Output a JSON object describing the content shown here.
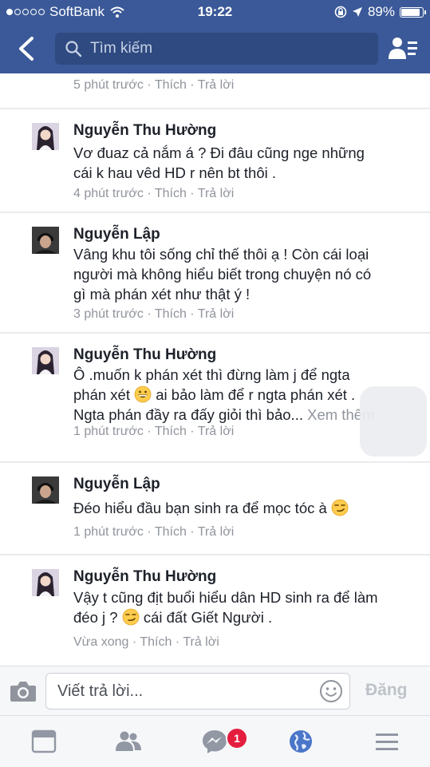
{
  "status_bar": {
    "carrier": "SoftBank",
    "time": "19:22",
    "battery_percent": "89%",
    "battery_level": 0.89
  },
  "nav": {
    "search_placeholder": "Tìm kiếm"
  },
  "comments": [
    {
      "author": "",
      "lines": [],
      "time": "5 phút trước",
      "like": "Thích",
      "reply": "Trả lời"
    },
    {
      "author": "Nguyễn Thu Hường",
      "lines": [
        "Vơ đuaz cả nắm á ? Đi đâu cũng nge những",
        "cái k hau vêd HD r nên bt thôi ."
      ],
      "time": "4 phút trước",
      "like": "Thích",
      "reply": "Trả lời"
    },
    {
      "author": "Nguyễn Lập",
      "lines": [
        "Vâng khu tôi sống chỉ thế thôi ạ ! Còn cái loại",
        "người mà không hiểu biết trong chuyện nó có",
        "gì mà phán xét như thật ý !"
      ],
      "time": "3 phút trước",
      "like": "Thích",
      "reply": "Trả lời"
    },
    {
      "author": "Nguyễn Thu Hường",
      "line1": "Ô .muốn k phán xét thì đừng làm j để ngta",
      "line2_before": "phán xét ",
      "line2_after": " ai bảo làm để r ngta phán xét .",
      "line3": "Ngta phán đầy ra đấy giỏi thì bảo...",
      "see_more": "Xem thêm",
      "emoji": "grinning-face-icon",
      "time": "1 phút trước",
      "like": "Thích",
      "reply": "Trả lời"
    },
    {
      "author": "Nguyễn Lập",
      "line1_before": "Đéo hiểu đầu bạn sinh ra để mọc tóc à ",
      "emoji": "smirking-face-icon",
      "time": "1 phút trước",
      "like": "Thích",
      "reply": "Trả lời"
    },
    {
      "author": "Nguyễn Thu Hường",
      "line1": "Vậy t cũng địt buổi hiểu dân HD sinh ra để làm",
      "line2_before": "đéo j ? ",
      "line2_after": " cái đất Giết Người .",
      "emoji": "smirking-face-icon",
      "time": "Vừa xong",
      "like": "Thích",
      "reply": "Trả lời"
    }
  ],
  "composer": {
    "placeholder": "Viết trả lời...",
    "post_label": "Đăng"
  },
  "tab_bar": {
    "messages_badge": "1"
  },
  "colors": {
    "brand": "#3b5998",
    "meta": "#90949c",
    "badge": "#e41e3f"
  }
}
